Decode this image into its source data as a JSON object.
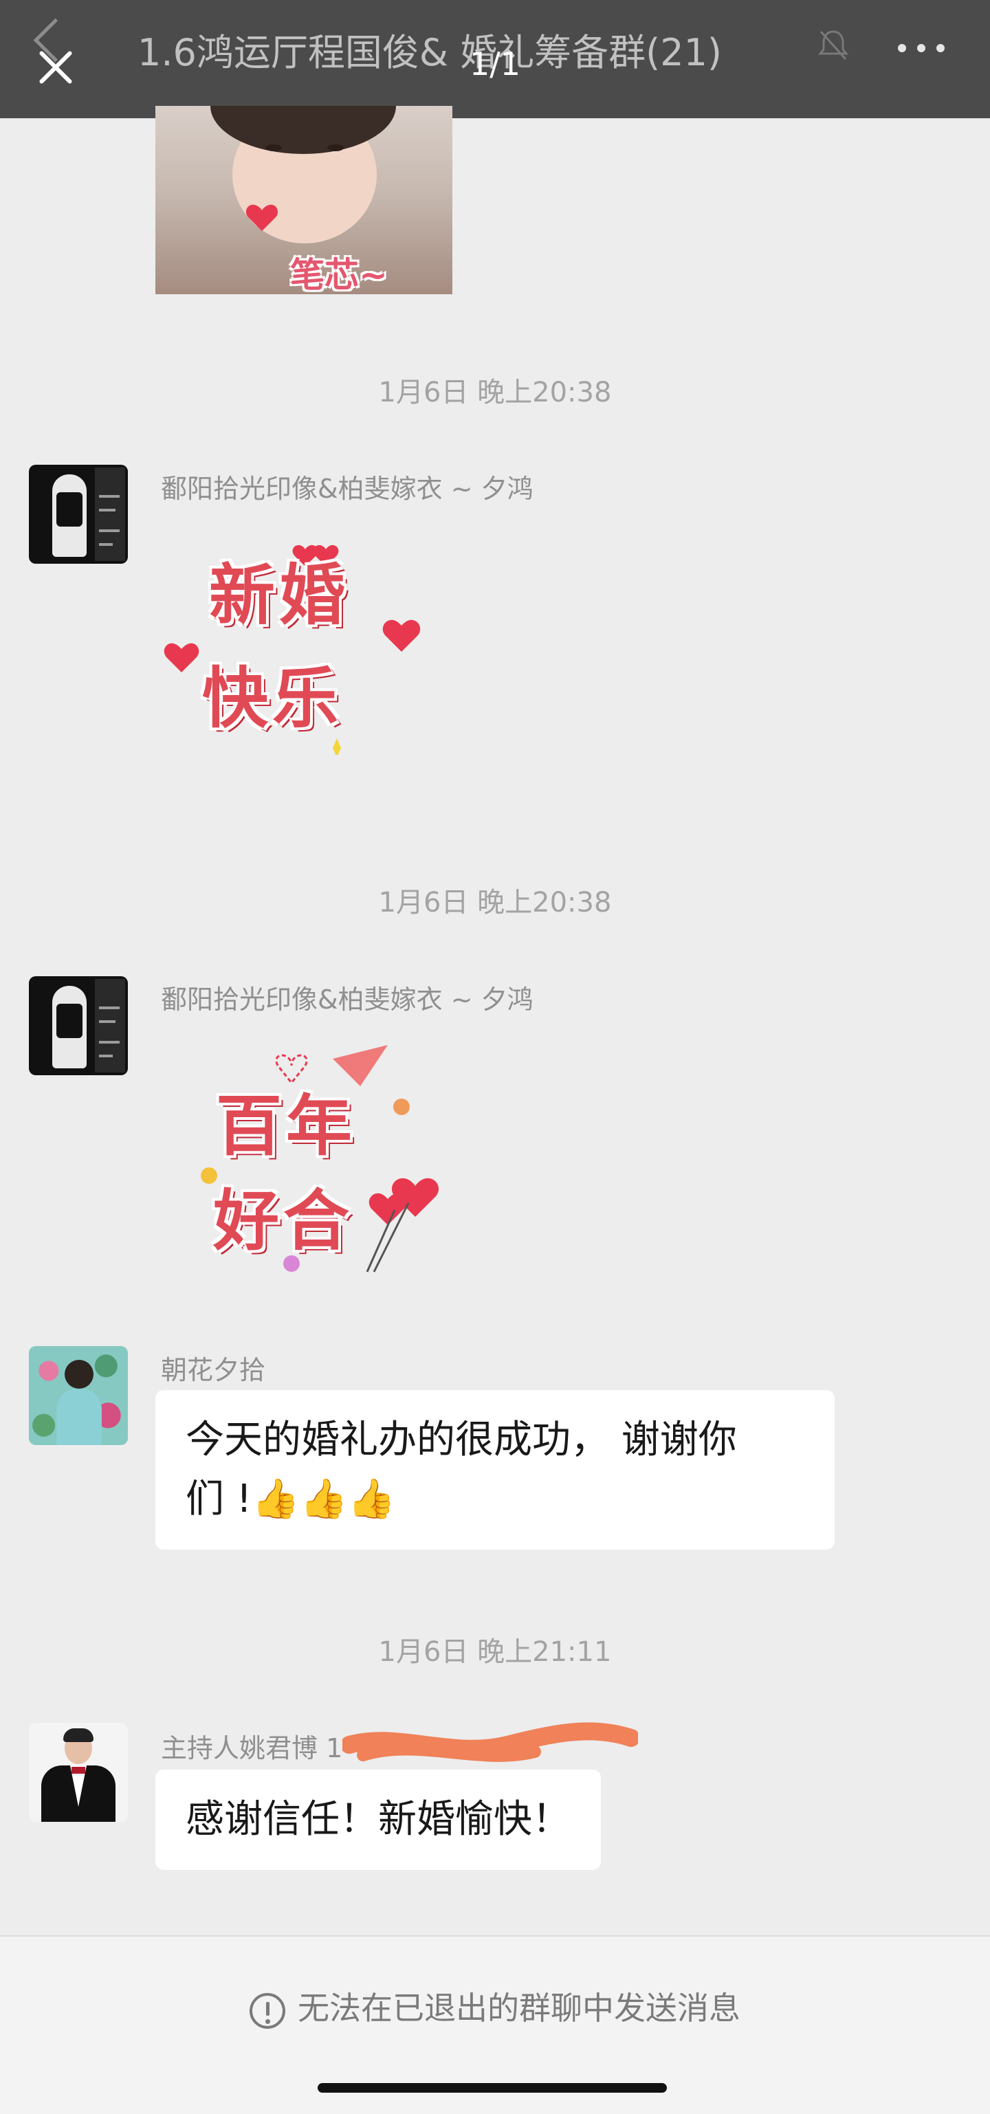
{
  "header": {
    "title": "1.6鸿运厅程国俊&    婚礼筹备群(21)",
    "counter": "1/1"
  },
  "first_sticker_caption": "笔芯~",
  "messages": [
    {
      "timestamp": "1月6日 晚上20:38",
      "sender": "鄱阳拾光印像&柏斐嫁衣 ~ 夕鸿",
      "sticker_lines": [
        "新婚",
        "快乐"
      ]
    },
    {
      "timestamp": "1月6日 晚上20:38",
      "sender": "鄱阳拾光印像&柏斐嫁衣 ~ 夕鸿",
      "sticker_lines": [
        "百年",
        "好合"
      ]
    },
    {
      "sender": "朝花夕拾",
      "text_line1": "今天的婚礼办的很成功， 谢谢你",
      "text_line2": "们 !👍👍👍"
    },
    {
      "timestamp": "1月6日 晚上21:11",
      "sender": "主持人姚君博 1",
      "text": "感谢信任！新婚愉快！"
    }
  ],
  "footer": {
    "notice": "无法在已退出的群聊中发送消息"
  },
  "colors": {
    "header_bg": "#4b4b4b",
    "chat_bg": "#ededed",
    "bubble_bg": "#ffffff",
    "redaction": "#f08158",
    "sticker_red": "#e04a55"
  }
}
